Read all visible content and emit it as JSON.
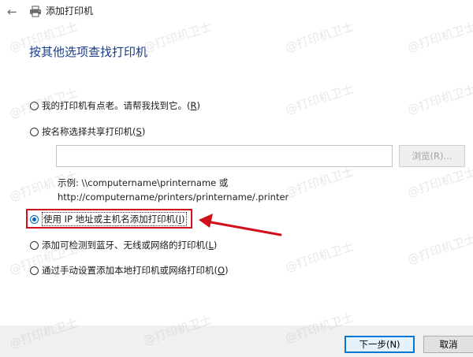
{
  "window": {
    "title": "添加打印机",
    "back_glyph": "←"
  },
  "heading": "按其他选项查找打印机",
  "options": [
    {
      "label": "我的打印机有点老。请帮我找到它。",
      "key": "R",
      "checked": false
    },
    {
      "label": "按名称选择共享打印机",
      "key": "S",
      "checked": false
    },
    {
      "label": "使用 IP 地址或主机名添加打印机",
      "key": "I",
      "checked": true
    },
    {
      "label": "添加可检测到蓝牙、无线或网络的打印机",
      "key": "L",
      "checked": false
    },
    {
      "label": "通过手动设置添加本地打印机或网络打印机",
      "key": "O",
      "checked": false
    }
  ],
  "share": {
    "input_value": "",
    "browse_label": "浏览(R)..."
  },
  "example": {
    "line1": "示例: \\\\computername\\printername 或",
    "line2": "http://computername/printers/printername/.printer"
  },
  "buttons": {
    "next_label": "下一步(N)",
    "cancel_label": "取消"
  },
  "watermark": "@打印机卫士",
  "colors": {
    "accent": "#0067c0",
    "highlight": "#d0101a",
    "heading": "#1a3c8c"
  }
}
